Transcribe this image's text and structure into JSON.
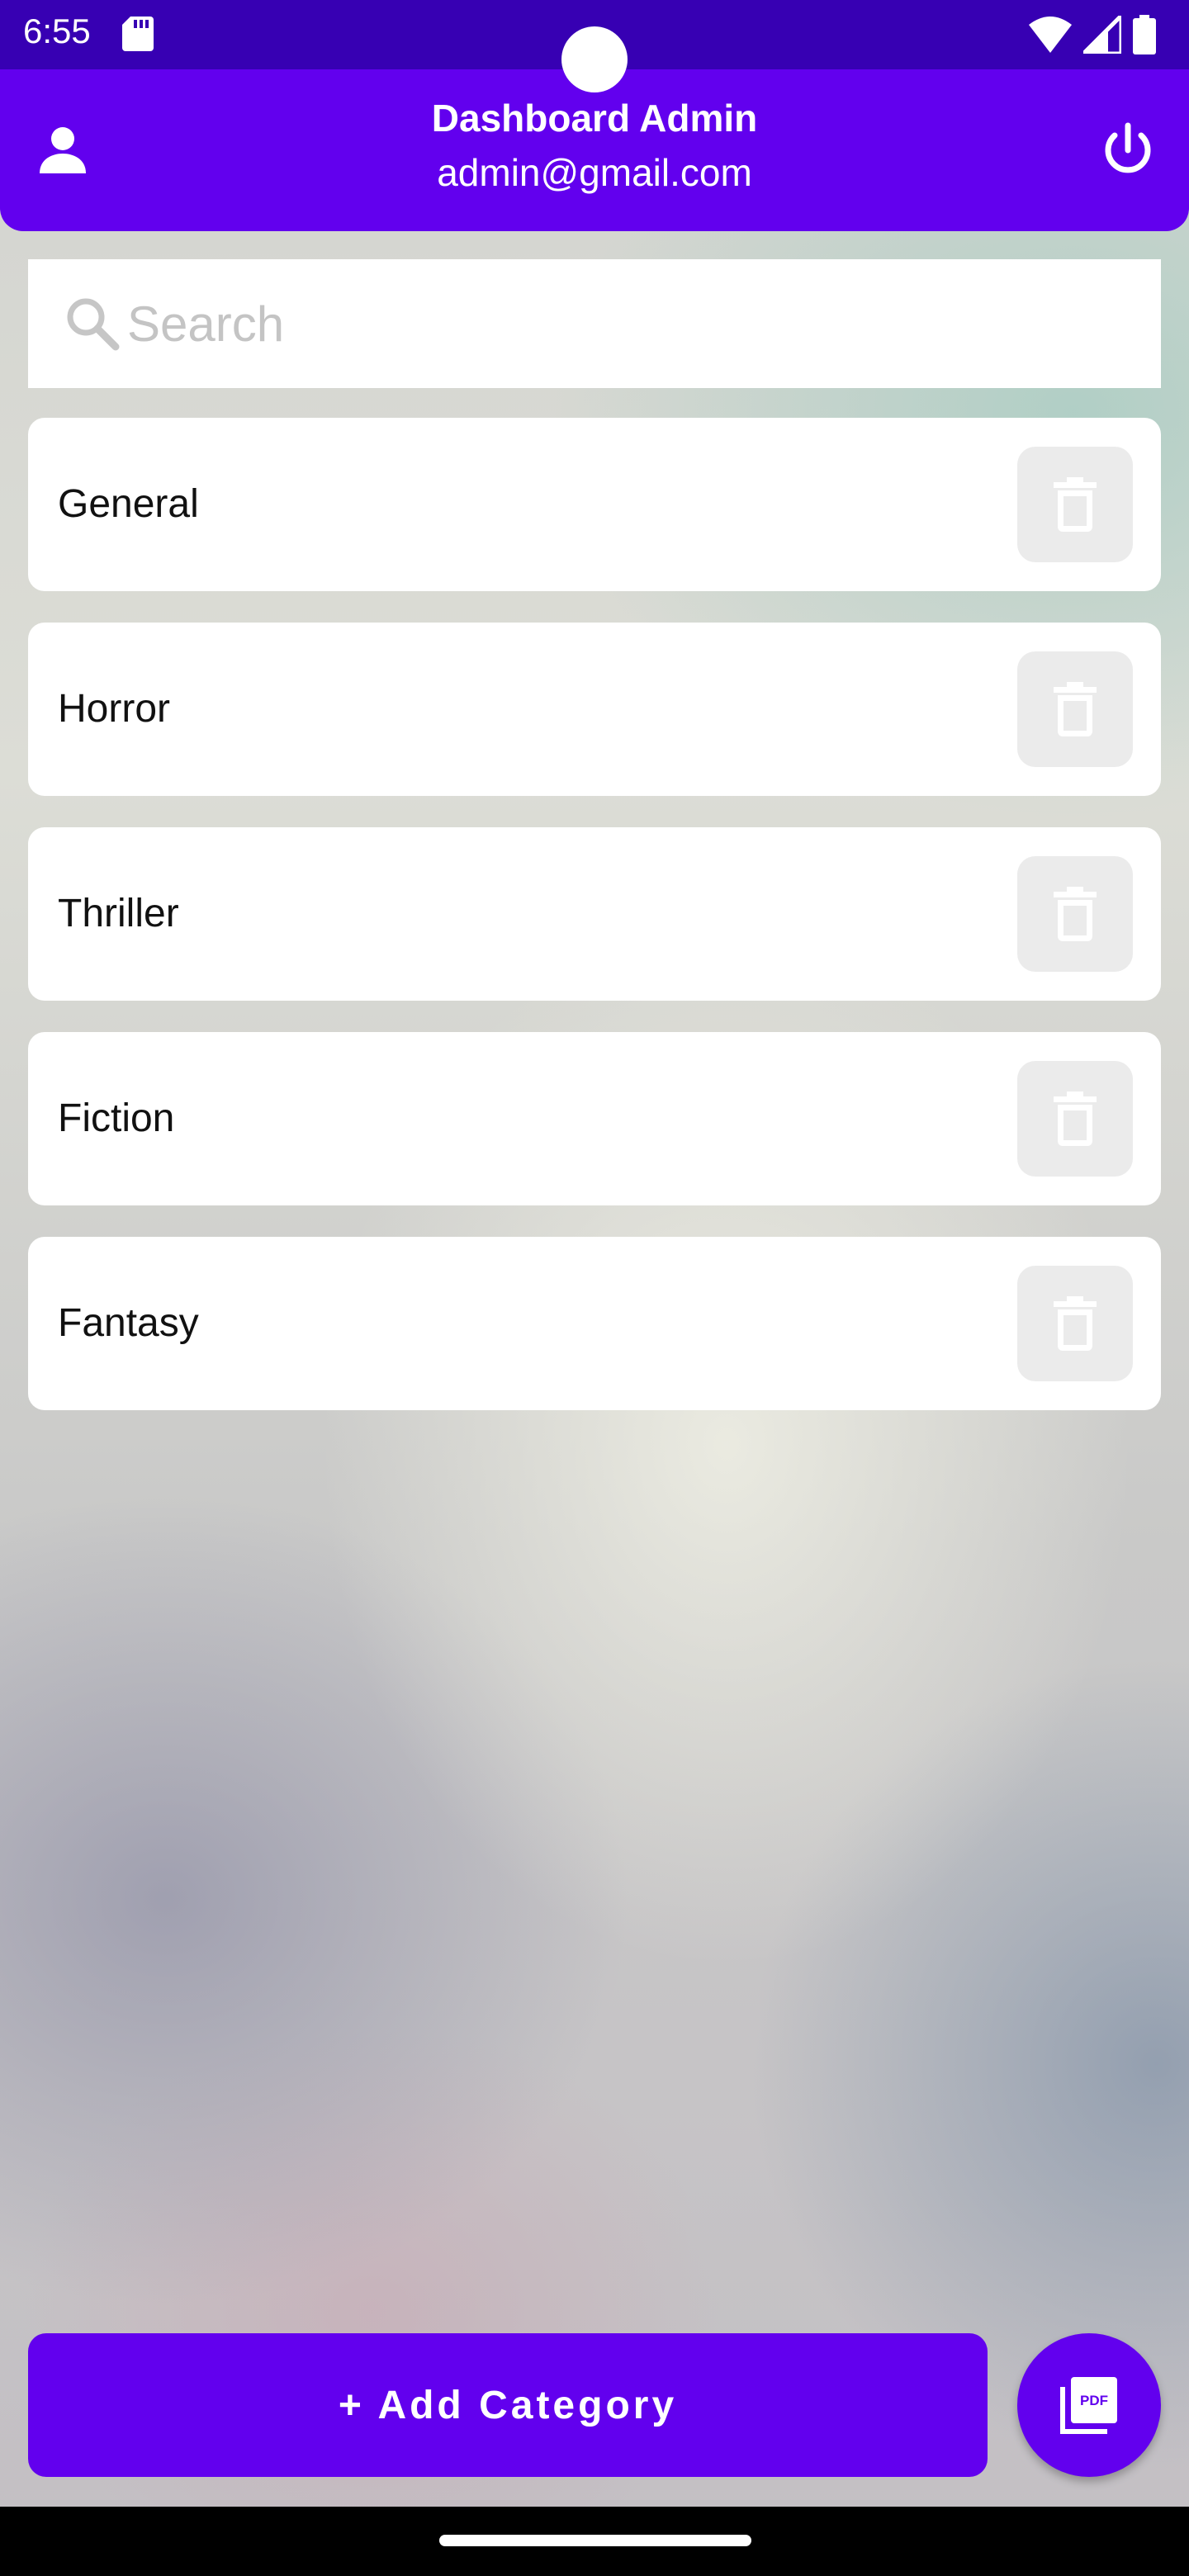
{
  "status_bar": {
    "time": "6:55",
    "icons": [
      "sd-card-icon",
      "wifi-icon",
      "cell-signal-icon",
      "battery-icon"
    ]
  },
  "app_bar": {
    "title": "Dashboard Admin",
    "subtitle": "admin@gmail.com",
    "left_icon": "person-icon",
    "right_icon": "power-icon"
  },
  "search": {
    "placeholder": "Search",
    "value": ""
  },
  "categories": [
    {
      "label": "General"
    },
    {
      "label": "Horror"
    },
    {
      "label": "Thriller"
    },
    {
      "label": "Fiction"
    },
    {
      "label": "Fantasy"
    }
  ],
  "bottom": {
    "add_label": "+ Add Category",
    "fab_icon": "pdf-icon"
  },
  "colors": {
    "status_bar": "#3700b3",
    "primary": "#6200ee",
    "delete_bg": "#ebebeb"
  }
}
